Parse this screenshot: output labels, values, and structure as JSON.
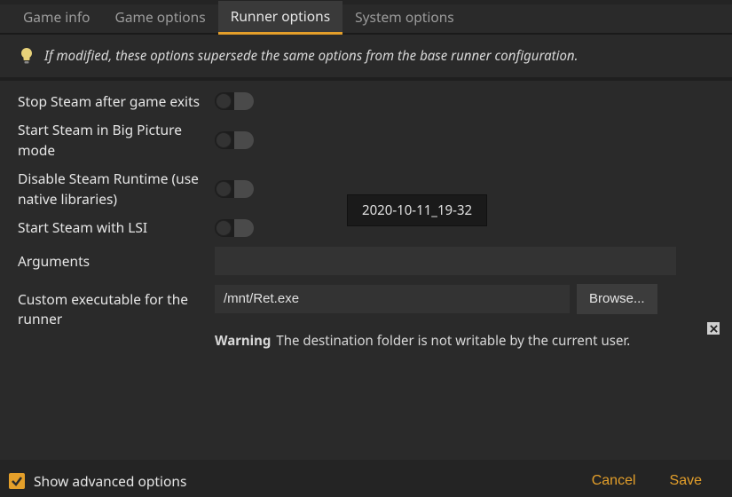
{
  "tabs": {
    "game_info": "Game info",
    "game_options": "Game options",
    "runner_options": "Runner options",
    "system_options": "System options"
  },
  "banner_text": "If modified, these options supersede the same options from the base runner configuration.",
  "options": {
    "stop_steam": "Stop Steam after game exits",
    "big_picture": "Start Steam in Big Picture mode",
    "disable_runtime": "Disable Steam Runtime (use native libraries)",
    "start_lsi": "Start Steam with LSI",
    "arguments": "Arguments",
    "custom_exec": "Custom executable for the runner"
  },
  "tooltip": "2020-10-11_19-32",
  "values": {
    "arguments": "",
    "custom_exec_path": "/mnt/Ret.exe"
  },
  "browse_label": "Browse...",
  "warning": {
    "label": "Warning",
    "text": "The destination folder is not writable by the current user."
  },
  "footer": {
    "show_advanced": "Show advanced options",
    "cancel": "Cancel",
    "save": "Save"
  }
}
